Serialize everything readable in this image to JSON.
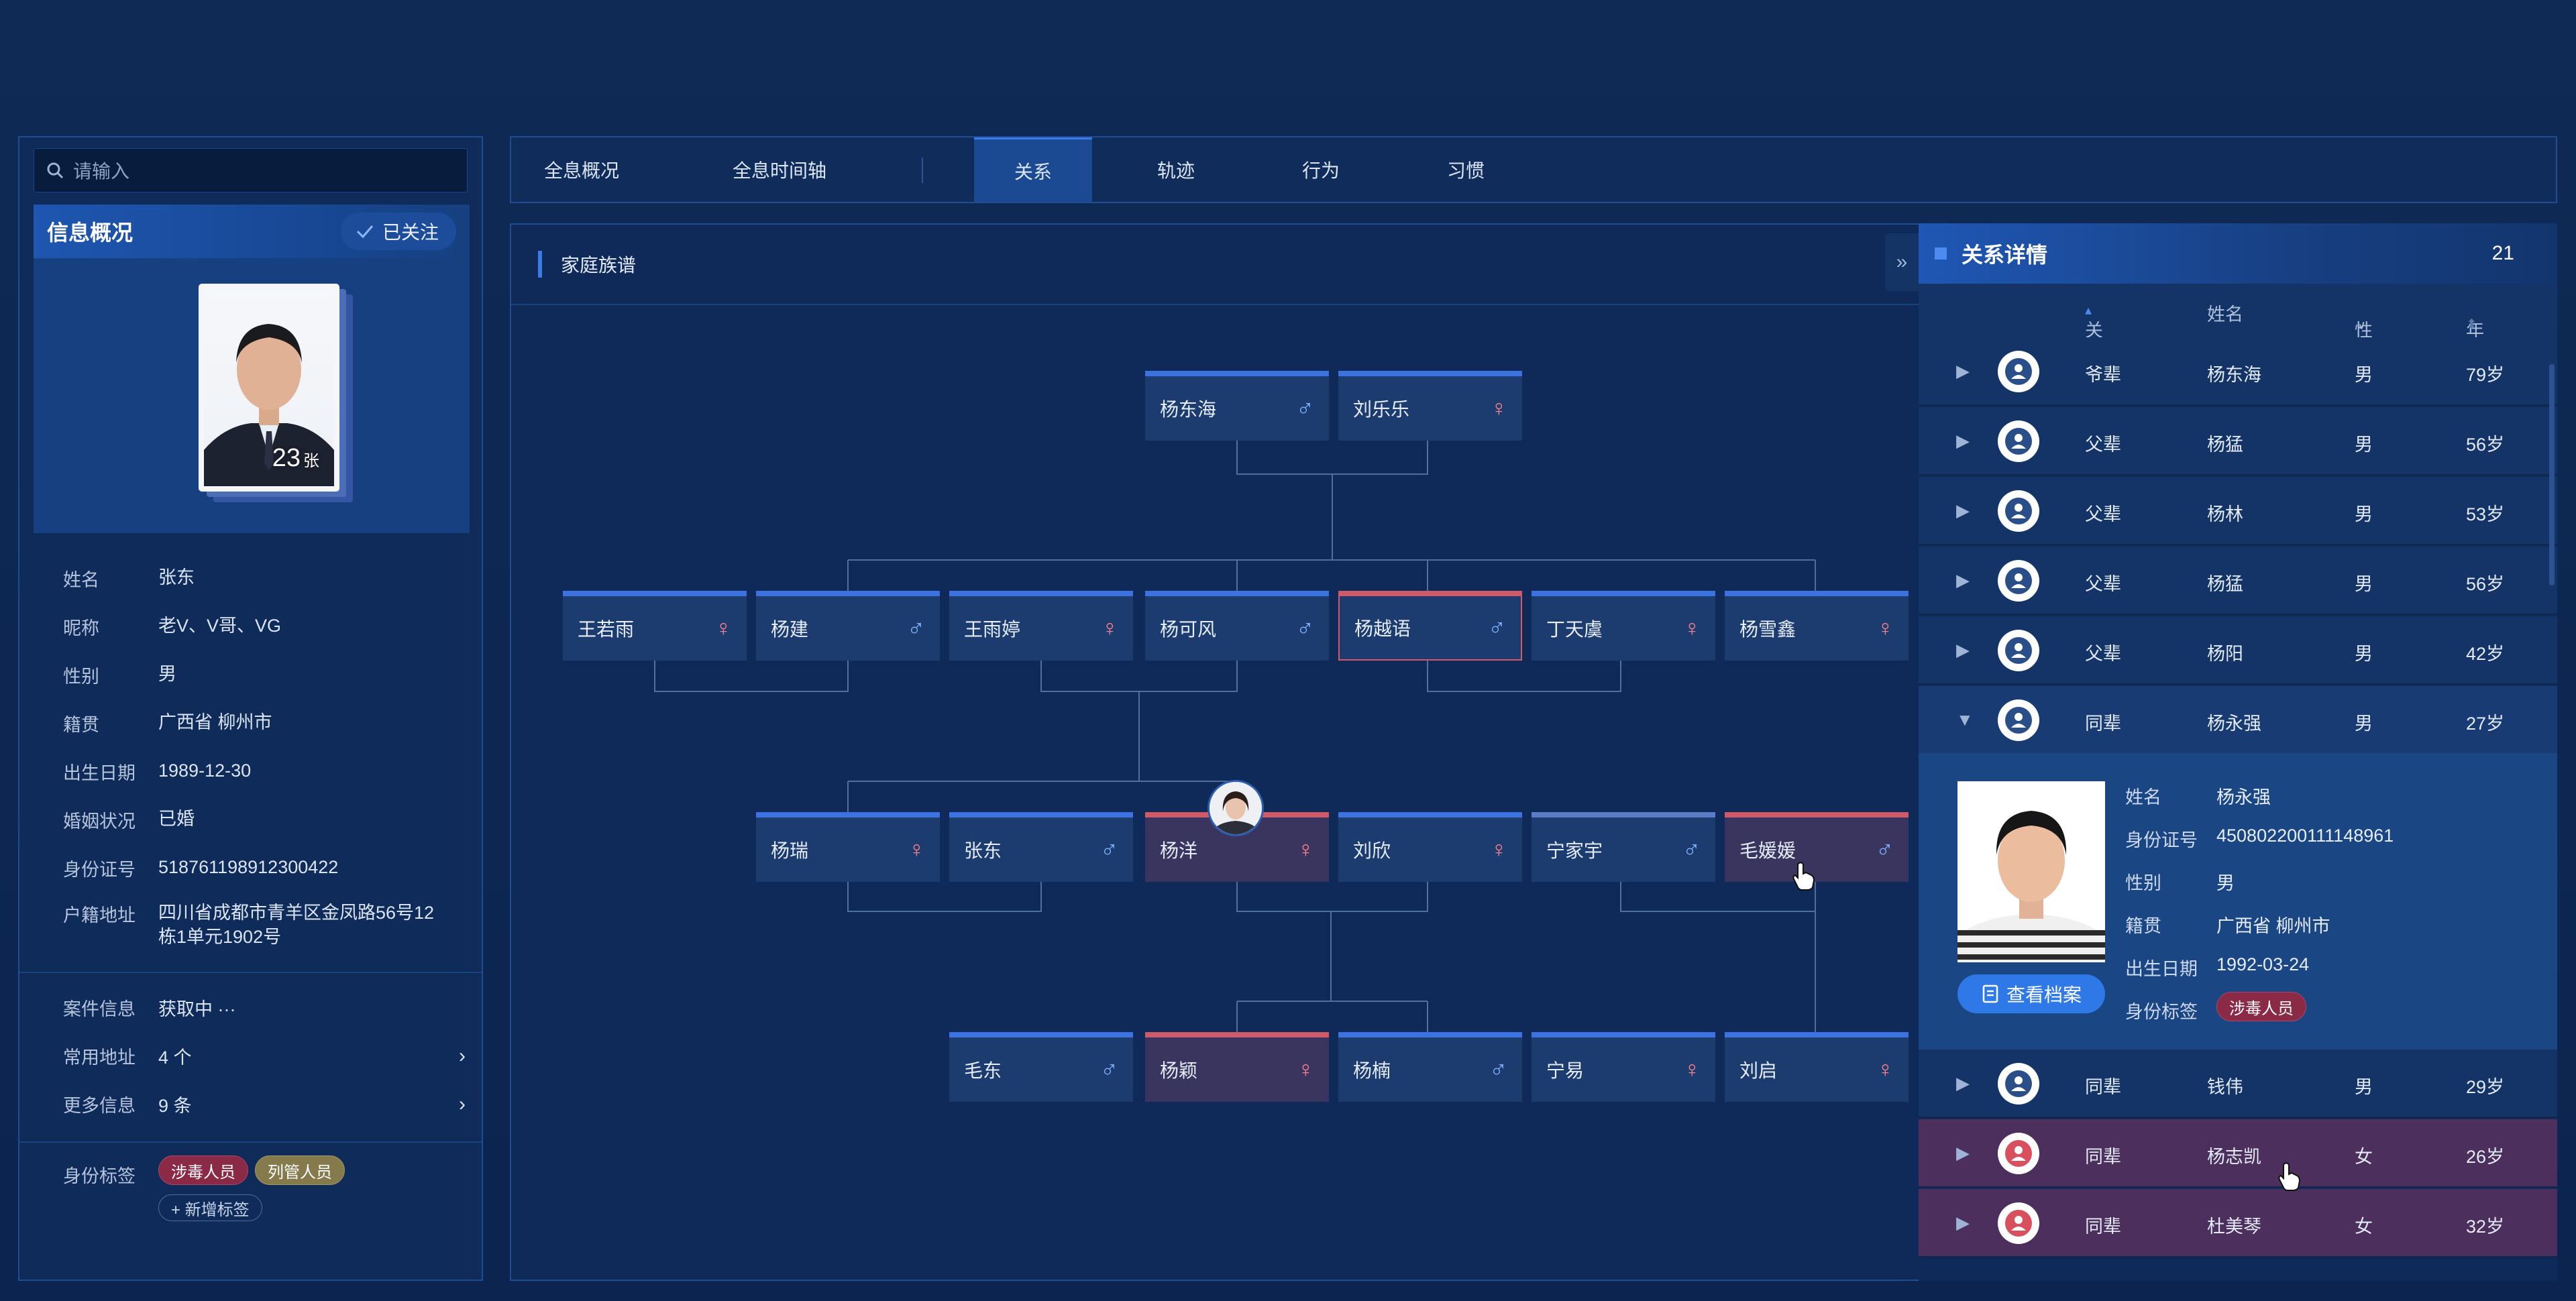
{
  "search": {
    "placeholder": "请输入"
  },
  "info": {
    "title": "信息概况",
    "follow_label": "已关注",
    "photo_count": "23",
    "photo_unit": "张",
    "fields": [
      {
        "k": "姓名",
        "v": "张东"
      },
      {
        "k": "昵称",
        "v": "老V、V哥、VG"
      },
      {
        "k": "性别",
        "v": "男"
      },
      {
        "k": "籍贯",
        "v": "广西省 柳州市"
      },
      {
        "k": "出生日期",
        "v": "1989-12-30"
      },
      {
        "k": "婚姻状况",
        "v": "已婚"
      },
      {
        "k": "身份证号",
        "v": "518761198912300422"
      },
      {
        "k": "户籍地址",
        "v": "四川省成都市青羊区金凤路56号12栋1单元1902号"
      }
    ],
    "case": {
      "k": "案件信息",
      "v": "获取中 ···"
    },
    "address": {
      "k": "常用地址",
      "v": "4 个"
    },
    "more": {
      "k": "更多信息",
      "v": "9 条"
    },
    "tags_label": "身份标签",
    "tags": [
      "涉毒人员",
      "列管人员"
    ],
    "add_tag": "+ 新增标签"
  },
  "tabs": [
    "全息概况",
    "全息时间轴",
    "关系",
    "轨迹",
    "行为",
    "习惯"
  ],
  "active_tab": "关系",
  "tree": {
    "title": "家庭族谱",
    "gen1": [
      {
        "name": "杨东海",
        "g": "♂"
      },
      {
        "name": "刘乐乐",
        "g": "♀"
      }
    ],
    "gen2": [
      {
        "name": "王若雨",
        "g": "♀"
      },
      {
        "name": "杨建",
        "g": "♂"
      },
      {
        "name": "王雨婷",
        "g": "♀"
      },
      {
        "name": "杨可风",
        "g": "♂"
      },
      {
        "name": "杨越语",
        "g": "♂"
      },
      {
        "name": "丁天虞",
        "g": "♀"
      },
      {
        "name": "杨雪鑫",
        "g": "♀"
      }
    ],
    "gen3": [
      {
        "name": "杨瑞",
        "g": "♀"
      },
      {
        "name": "张东",
        "g": "♂"
      },
      {
        "name": "杨洋",
        "g": "♀"
      },
      {
        "name": "刘欣",
        "g": "♀"
      },
      {
        "name": "宁家宇",
        "g": "♂"
      },
      {
        "name": "毛媛媛",
        "g": "♂"
      }
    ],
    "gen4": [
      {
        "name": "毛东",
        "g": "♂"
      },
      {
        "name": "杨颖",
        "g": "♀"
      },
      {
        "name": "杨楠",
        "g": "♂"
      },
      {
        "name": "宁易",
        "g": "♀"
      },
      {
        "name": "刘启",
        "g": "♀"
      }
    ]
  },
  "detail": {
    "title": "关系详情",
    "count": "21",
    "columns": {
      "relation": "关系",
      "name": "姓名",
      "gender": "性别",
      "age": "年龄"
    },
    "rows": [
      {
        "relation": "爷辈",
        "name": "杨东海",
        "gender": "男",
        "age": "79岁"
      },
      {
        "relation": "父辈",
        "name": "杨猛",
        "gender": "男",
        "age": "56岁"
      },
      {
        "relation": "父辈",
        "name": "杨林",
        "gender": "男",
        "age": "53岁"
      },
      {
        "relation": "父辈",
        "name": "杨猛",
        "gender": "男",
        "age": "56岁"
      },
      {
        "relation": "父辈",
        "name": "杨阳",
        "gender": "男",
        "age": "42岁"
      },
      {
        "relation": "同辈",
        "name": "杨永强",
        "gender": "男",
        "age": "27岁"
      }
    ],
    "expanded": {
      "fields": [
        {
          "k": "姓名",
          "v": "杨永强"
        },
        {
          "k": "身份证号",
          "v": "450802200111148961"
        },
        {
          "k": "性别",
          "v": "男"
        },
        {
          "k": "籍贯",
          "v": "广西省 柳州市"
        },
        {
          "k": "出生日期",
          "v": "1992-03-24"
        },
        {
          "k": "身份标签",
          "v": ""
        }
      ],
      "view_btn": "查看档案",
      "tag": "涉毒人员"
    },
    "rows_after": [
      {
        "relation": "同辈",
        "name": "钱伟",
        "gender": "男",
        "age": "29岁"
      },
      {
        "relation": "同辈",
        "name": "杨志凯",
        "gender": "女",
        "age": "26岁"
      },
      {
        "relation": "同辈",
        "name": "杜美琴",
        "gender": "女",
        "age": "32岁"
      }
    ]
  },
  "colors": {
    "accent": "#3b7ae8",
    "female": "#d15a68",
    "male": "#7fb1ff"
  }
}
